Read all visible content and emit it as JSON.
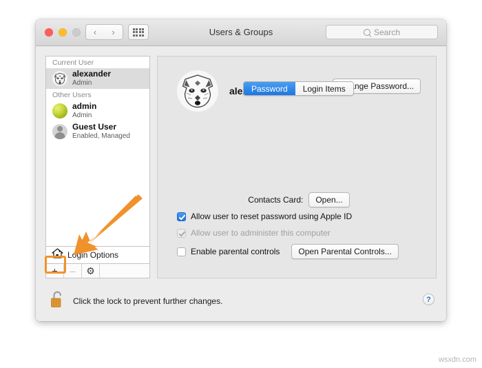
{
  "window": {
    "title": "Users & Groups",
    "traffic_lights": [
      "close",
      "minimize",
      "zoom"
    ],
    "nav": {
      "back": "‹",
      "forward": "›"
    },
    "grid_button": "show-all-preferences"
  },
  "search": {
    "placeholder": "Search",
    "value": ""
  },
  "sidebar": {
    "groups": [
      {
        "header": "Current User",
        "users": [
          {
            "name": "alexander",
            "status": "Admin",
            "avatar": "fox-avatar",
            "selected": true
          }
        ]
      },
      {
        "header": "Other Users",
        "users": [
          {
            "name": "admin",
            "status": "Admin",
            "avatar": "ball-avatar",
            "selected": false
          },
          {
            "name": "Guest User",
            "status": "Enabled, Managed",
            "avatar": "guest-avatar",
            "selected": false
          }
        ]
      }
    ],
    "login_options": "Login Options",
    "toolbar": {
      "add": "+",
      "remove": "–",
      "gear": "⚙"
    }
  },
  "main": {
    "tabs": [
      {
        "label": "Password",
        "active": true
      },
      {
        "label": "Login Items",
        "active": false
      }
    ],
    "account_name": "alexander",
    "change_password_label": "Change Password...",
    "contacts_card_label": "Contacts Card:",
    "contacts_open_label": "Open...",
    "checkboxes": [
      {
        "label": "Allow user to reset password using Apple ID",
        "checked": true,
        "disabled": false
      },
      {
        "label": "Allow user to administer this computer",
        "checked": true,
        "disabled": true
      },
      {
        "label": "Enable parental controls",
        "checked": false,
        "disabled": false
      }
    ],
    "parental_controls_label": "Open Parental Controls..."
  },
  "bottom": {
    "lock_text": "Click the lock to prevent further changes.",
    "lock_state": "unlocked",
    "help_label": "?"
  },
  "annotations": {
    "arrow_color": "#F0922B",
    "highlight_target": "add-user-button"
  },
  "watermark": "wsxdn.com",
  "colors": {
    "accent_blue": "#1f76e0",
    "annotation_orange": "#F0922B",
    "window_bg": "#ECECEC",
    "panel_bg": "#E6E6E6"
  }
}
